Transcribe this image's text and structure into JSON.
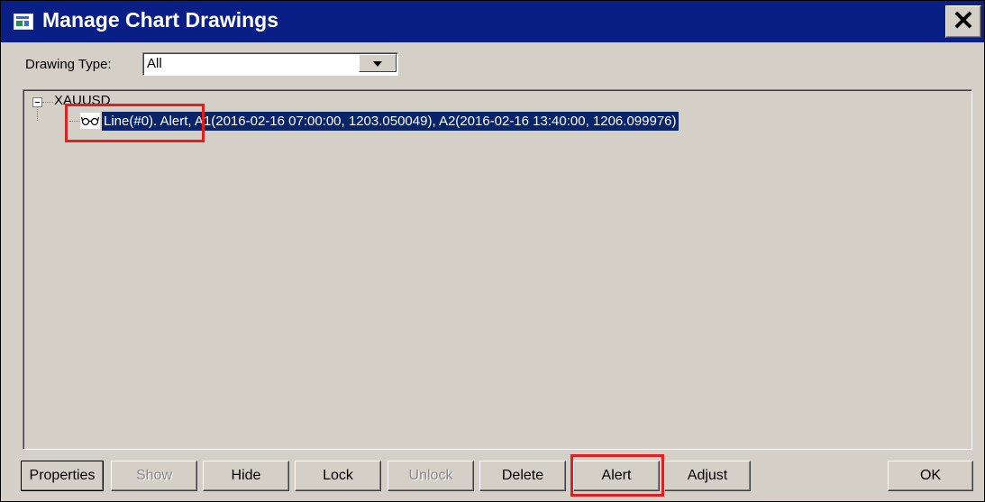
{
  "window": {
    "title": "Manage Chart Drawings",
    "close_glyph": "✕"
  },
  "filter": {
    "label": "Drawing Type:",
    "selected": "All"
  },
  "tree": {
    "root": "XAUUSD",
    "items": [
      {
        "icon": "glasses-icon",
        "label": "Line(#0). Alert, A1(2016-02-16  07:00:00, 1203.050049), A2(2016-02-16  13:40:00, 1206.099976)",
        "selected": true
      }
    ]
  },
  "buttons": {
    "properties": "Properties",
    "show": "Show",
    "hide": "Hide",
    "lock": "Lock",
    "unlock": "Unlock",
    "delete": "Delete",
    "alert": "Alert",
    "adjust": "Adjust",
    "ok": "OK"
  },
  "colors": {
    "titlebar": "#0a1f86",
    "selection": "#0a246a",
    "highlight_box": "#e02020"
  }
}
